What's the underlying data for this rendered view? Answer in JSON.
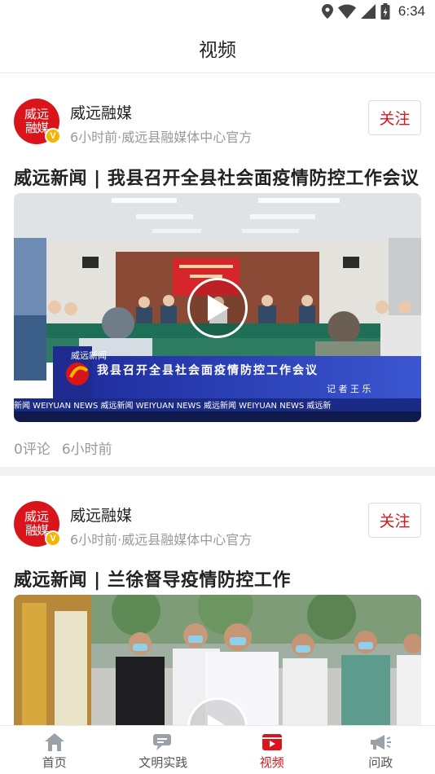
{
  "status_bar": {
    "time": "6:34"
  },
  "header": {
    "title": "视频"
  },
  "posts": [
    {
      "avatar_text": [
        "威远",
        "融媒"
      ],
      "verified_mark": "V",
      "author": "威远融媒",
      "meta": "6小时前·威远县融媒体中心官方",
      "follow_label": "关注",
      "title": "威远新闻 | 我县召开全县社会面疫情防控工作会议",
      "video_caption": "我县召开全县社会面疫情防控工作会议",
      "video_reporter": "记 者  王 乐",
      "video_ticker": "新闻 WEIYUAN NEWS 威远新闻 WEIYUAN NEWS 威远新闻 WEIYUAN NEWS 威远新",
      "video_logo": "威远新闻",
      "comments": "0评论",
      "time": "6小时前"
    },
    {
      "avatar_text": [
        "威远",
        "融媒"
      ],
      "verified_mark": "V",
      "author": "威远融媒",
      "meta": "6小时前·威远县融媒体中心官方",
      "follow_label": "关注",
      "title": "威远新闻 | 兰徐督导疫情防控工作"
    }
  ],
  "tabbar": {
    "items": [
      {
        "label": "首页",
        "icon": "home-icon"
      },
      {
        "label": "文明实践",
        "icon": "practice-icon"
      },
      {
        "label": "视频",
        "icon": "video-icon",
        "active": true
      },
      {
        "label": "问政",
        "icon": "megaphone-icon"
      }
    ]
  },
  "colors": {
    "accent": "#d9141a",
    "muted": "#999999",
    "verified": "#f4b400"
  }
}
